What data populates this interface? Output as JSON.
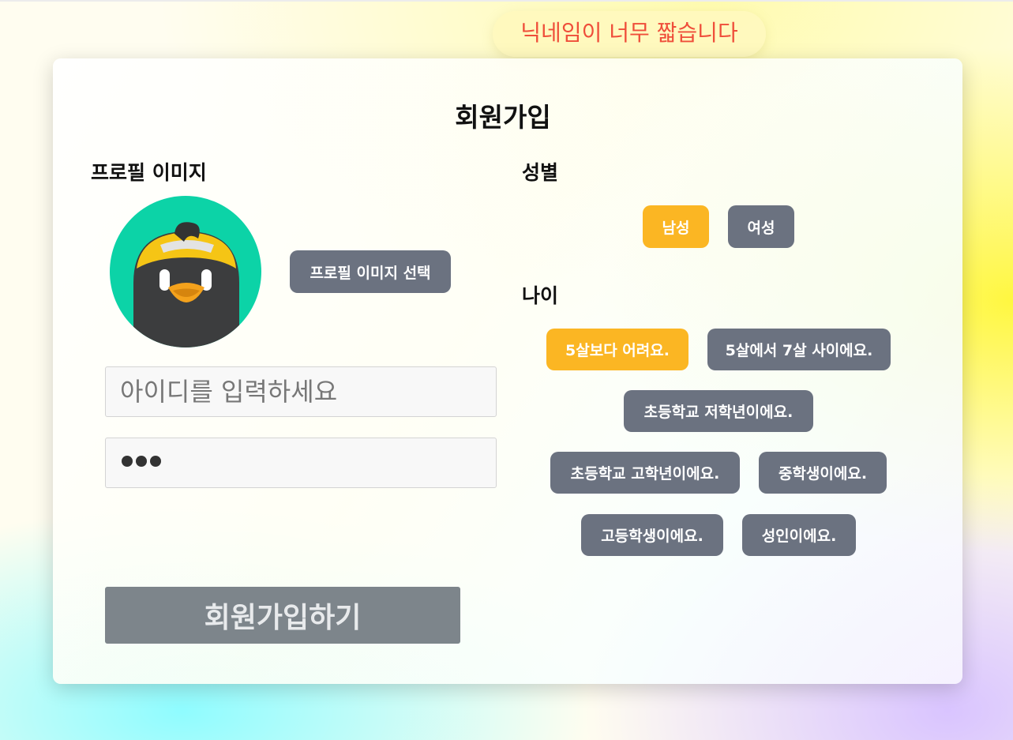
{
  "toast": {
    "message": "닉네임이 너무 짧습니다"
  },
  "form": {
    "title": "회원가입",
    "profile": {
      "label": "프로필 이미지",
      "select_button": "프로필 이미지 선택"
    },
    "id_field": {
      "placeholder": "아이디를 입력하세요",
      "value": ""
    },
    "password_field": {
      "masked_length": 3
    },
    "submit_label": "회원가입하기",
    "gender": {
      "label": "성별",
      "options": [
        "남성",
        "여성"
      ],
      "selected": "남성"
    },
    "age": {
      "label": "나이",
      "options": [
        "5살보다 어려요.",
        "5살에서 7살 사이에요.",
        "초등학교 저학년이에요.",
        "초등학교 고학년이에요.",
        "중학생이에요.",
        "고등학생이에요.",
        "성인이에요."
      ],
      "selected": "5살보다 어려요."
    }
  },
  "colors": {
    "selected": "#fbb623",
    "unselected": "#6b7280",
    "toast_text": "#ef4e3a",
    "submit_disabled": "#7d858b",
    "avatar_bg": "#0cd3a7"
  },
  "icons": {
    "avatar": "penguin-avatar-icon"
  }
}
